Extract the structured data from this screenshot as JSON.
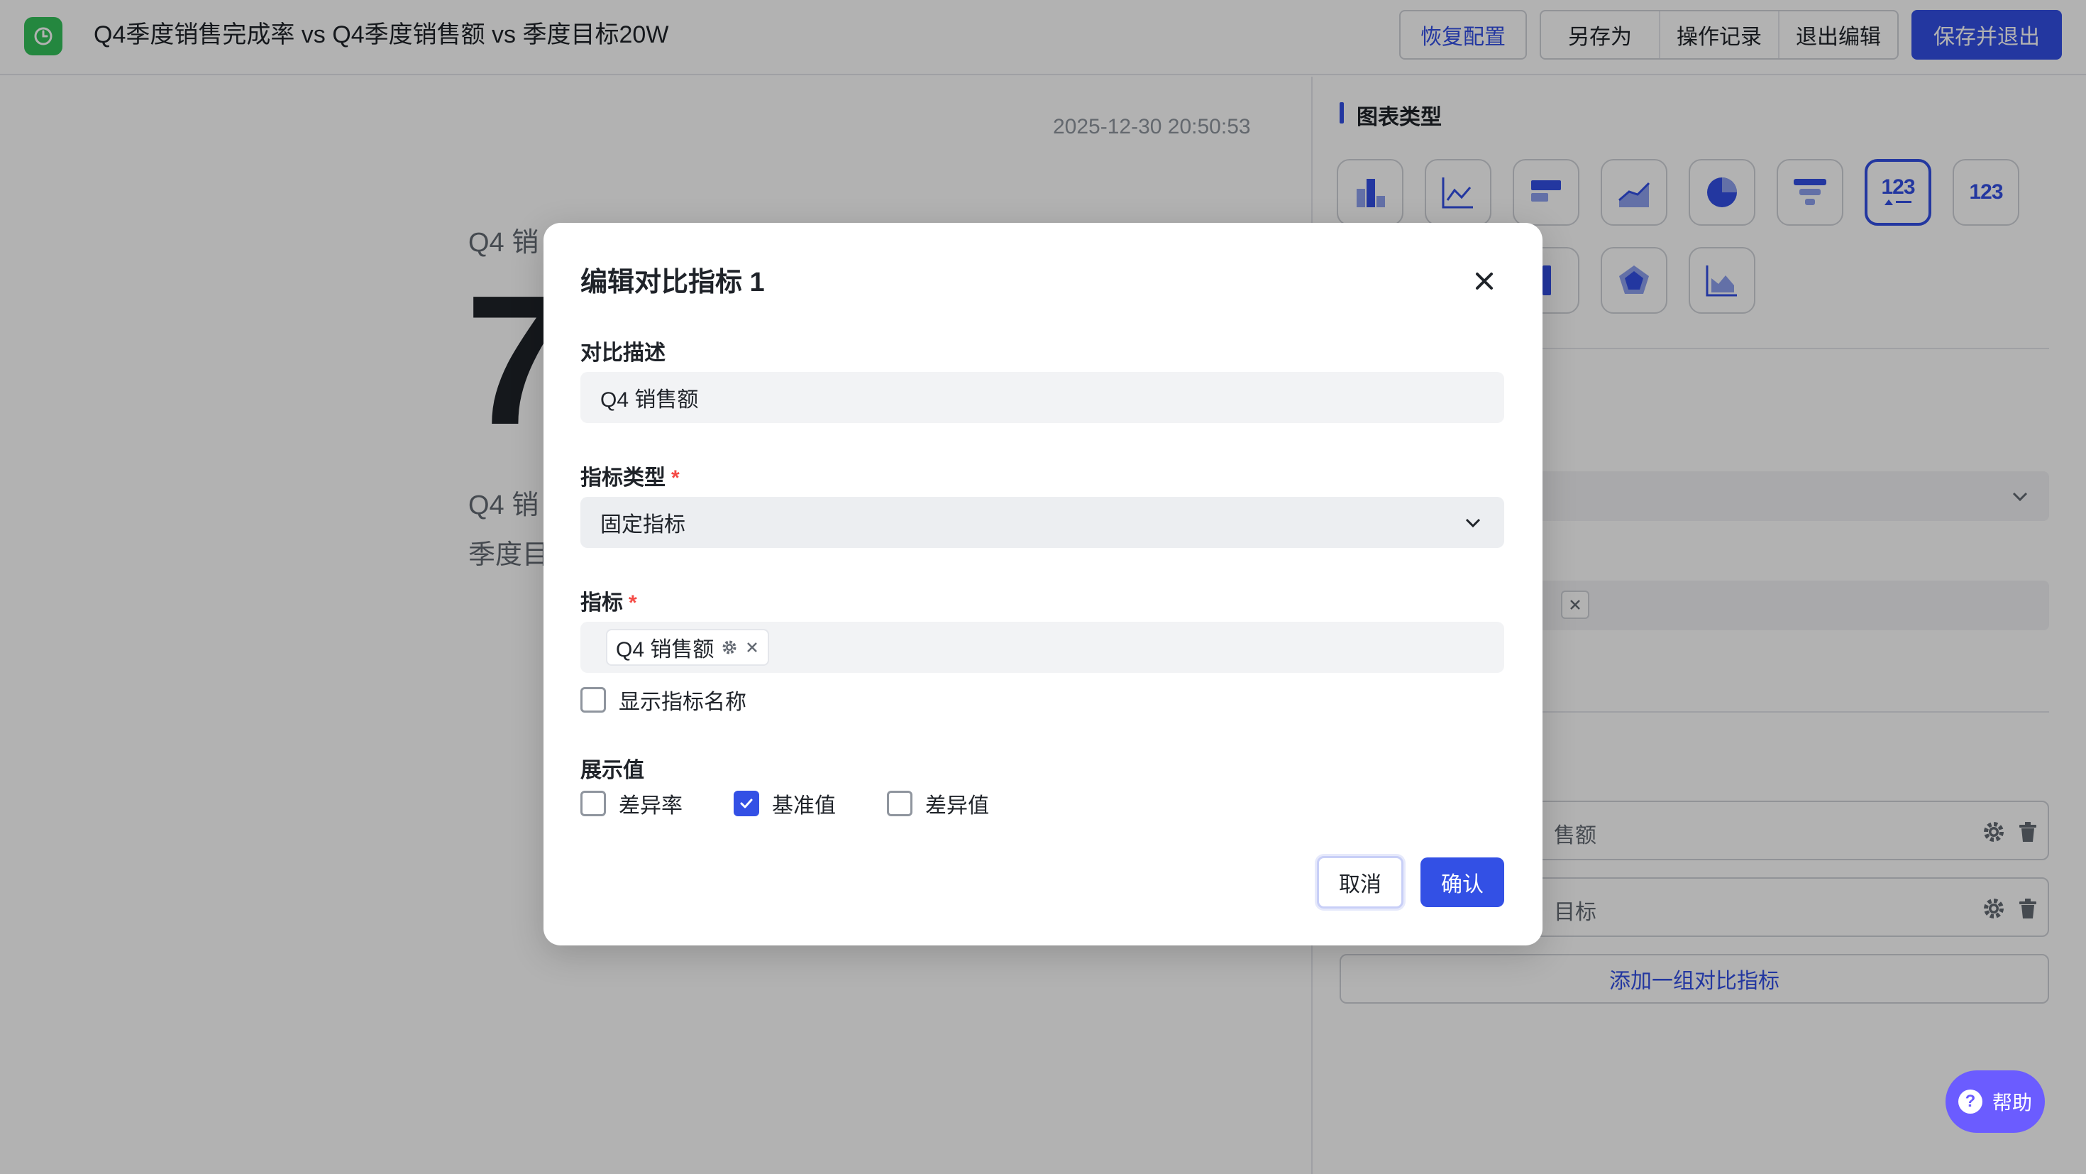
{
  "topbar": {
    "title": "Q4季度销售完成率 vs Q4季度销售额 vs 季度目标20W",
    "restore_label": "恢复配置",
    "save_as_label": "另存为",
    "history_label": "操作记录",
    "exit_edit_label": "退出编辑",
    "save_exit_label": "保存并退出"
  },
  "preview": {
    "timestamp": "2025-12-30 20:50:53",
    "label1": "Q4 销",
    "big_value": "7",
    "label2": "Q4 销",
    "label3": "季度目"
  },
  "panel": {
    "chart_type_title": "图表类型",
    "chart_types": [
      {
        "icon": "bar-chart-icon"
      },
      {
        "icon": "line-chart-icon"
      },
      {
        "icon": "horizontal-bar-icon"
      },
      {
        "icon": "area-chart-icon"
      },
      {
        "icon": "pie-chart-icon"
      },
      {
        "icon": "funnel-chart-icon"
      },
      {
        "icon": "indicator-compare-icon",
        "label": "123",
        "selected": true
      },
      {
        "icon": "indicator-card-icon",
        "label": "123"
      },
      {
        "icon": "column-chart-icon"
      },
      {
        "icon": "radar-chart-icon"
      },
      {
        "icon": "combo-chart-icon"
      }
    ],
    "metric_rows": [
      {
        "text": "售额"
      },
      {
        "text": "目标"
      }
    ],
    "add_compare_label": "添加一组对比指标",
    "help_label": "帮助"
  },
  "modal": {
    "title": "编辑对比指标 1",
    "desc_label": "对比描述",
    "desc_value": "Q4 销售额",
    "type_label": "指标类型",
    "type_value": "固定指标",
    "metric_label": "指标",
    "metric_tag": "Q4 销售额",
    "show_name_label": "显示指标名称",
    "show_name_checked": false,
    "display_label": "展示值",
    "display_options": [
      {
        "label": "差异率",
        "checked": false
      },
      {
        "label": "基准值",
        "checked": true
      },
      {
        "label": "差异值",
        "checked": false
      }
    ],
    "cancel_label": "取消",
    "confirm_label": "确认"
  },
  "colors": {
    "accent": "#3350e5",
    "required": "#f54a45",
    "logo": "#34c25b",
    "help": "#6b5cff"
  }
}
